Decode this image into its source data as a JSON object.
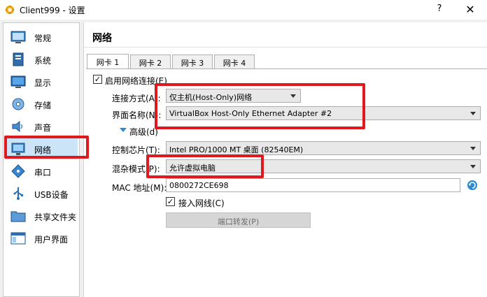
{
  "window": {
    "title": "Client999 - 设置",
    "help": "?",
    "close": "✕"
  },
  "sidebar": {
    "items": [
      {
        "label": "常规",
        "icon": "general-icon"
      },
      {
        "label": "系统",
        "icon": "system-icon"
      },
      {
        "label": "显示",
        "icon": "display-icon"
      },
      {
        "label": "存储",
        "icon": "storage-icon"
      },
      {
        "label": "声音",
        "icon": "audio-icon"
      },
      {
        "label": "网络",
        "icon": "network-icon",
        "selected": true
      },
      {
        "label": "串口",
        "icon": "serial-port-icon"
      },
      {
        "label": "USB设备",
        "icon": "usb-icon"
      },
      {
        "label": "共享文件夹",
        "icon": "shared-folder-icon"
      },
      {
        "label": "用户界面",
        "icon": "user-interface-icon"
      }
    ]
  },
  "page": {
    "title": "网络"
  },
  "tabs": [
    {
      "label": "网卡 1",
      "active": true
    },
    {
      "label": "网卡 2"
    },
    {
      "label": "网卡 3"
    },
    {
      "label": "网卡 4"
    }
  ],
  "adapter": {
    "enable_label": "启用网络连接(E)",
    "enabled": true,
    "attached_label": "连接方式(A):",
    "attached_value": "仅主机(Host-Only)网络",
    "name_label": "界面名称(N):",
    "name_value": "VirtualBox Host-Only Ethernet Adapter #2",
    "advanced_label": "高级(d)",
    "chip_label": "控制芯片(T):",
    "chip_value": "Intel PRO/1000 MT 桌面 (82540EM)",
    "promisc_label": "混杂模式(P):",
    "promisc_value": "允许虚拟电脑",
    "mac_label": "MAC 地址(M):",
    "mac_value": "0800272CE698",
    "cable_label": "接入网线(C)",
    "cable_connected": true,
    "port_forward_label": "端口转发(P)"
  },
  "colors": {
    "highlight_box": "#e0191f",
    "selected_bg": "#cce4f7"
  }
}
